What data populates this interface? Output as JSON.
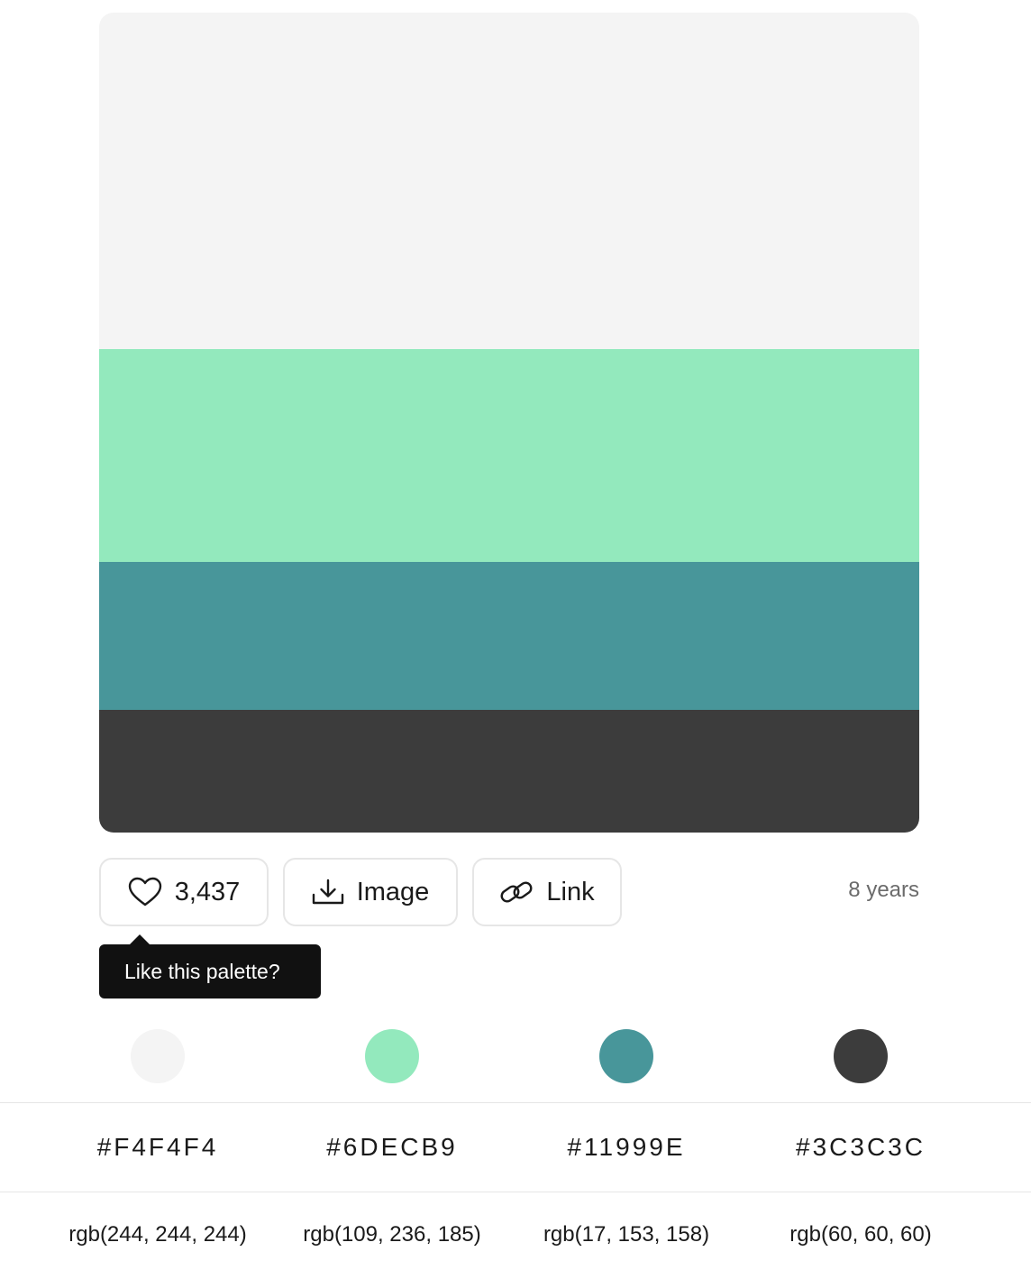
{
  "palette": {
    "colors": [
      {
        "hex": "#F4F4F4",
        "rgb": "rgb(244, 244, 244)",
        "swatch": "#f4f4f4"
      },
      {
        "hex": "#6DECB9",
        "rgb": "rgb(109, 236, 185)",
        "swatch": "#93e9bd"
      },
      {
        "hex": "#11999E",
        "rgb": "rgb(17, 153, 158)",
        "swatch": "#48969a"
      },
      {
        "hex": "#3C3C3C",
        "rgb": "rgb(60, 60, 60)",
        "swatch": "#3c3c3c"
      }
    ]
  },
  "actions": {
    "like_count": "3,437",
    "image_label": "Image",
    "link_label": "Link",
    "age": "8 years"
  },
  "tooltip": {
    "text": "Like this palette?"
  }
}
